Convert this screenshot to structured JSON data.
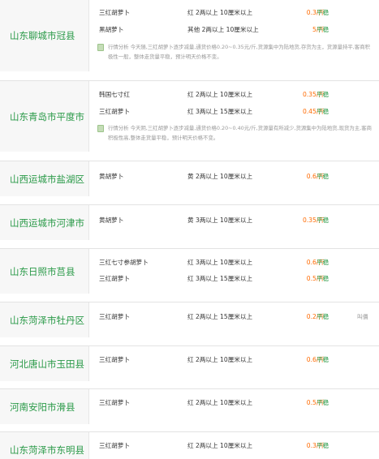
{
  "markets": [
    {
      "region": "山东聊城市冠县",
      "rows": [
        {
          "name": "三红胡萝卜",
          "spec": "红 2两以上 10厘米以上",
          "price": "0.3/斤",
          "trend": "平稳",
          "extra": ""
        },
        {
          "name": "黑胡萝卜",
          "spec": "其他 2两以上 10厘米以上",
          "price": "5/斤",
          "trend": "平稳",
          "extra": ""
        }
      ],
      "note": "行情分析 今天随,三红胡萝卜逐步减量,通货价格0.20~0.35元/斤,货源集中为陆地货,存货为主，货源量持平,客商积极性一般，整体走货量平稳，预计明天价格不变。"
    },
    {
      "region": "山东青岛市平度市",
      "rows": [
        {
          "name": "韩国七寸红",
          "spec": "红 2两以上 10厘米以上",
          "price": "0.35/斤",
          "trend": "平稳",
          "extra": ""
        },
        {
          "name": "三红胡萝卜",
          "spec": "红 3两以上 15厘米以上",
          "price": "0.45/斤",
          "trend": "平稳",
          "extra": ""
        }
      ],
      "note": "行情分析 今天阴,三红胡萝卜逐步减量,通货价格0.20~0.40元/斤,货源量有所减少,货源集中为陆地货,现货为主,客商积极性高,整体走货量平稳，预计明天价格不变。"
    },
    {
      "region": "山西运城市盐湖区",
      "rows": [
        {
          "name": "黄胡萝卜",
          "spec": "黄 2两以上 10厘米以上",
          "price": "0.6/斤",
          "trend": "平稳",
          "extra": ""
        }
      ],
      "note": ""
    },
    {
      "region": "山西运城市河津市",
      "rows": [
        {
          "name": "黄胡萝卜",
          "spec": "黄 3两以上 10厘米以上",
          "price": "0.35/斤",
          "trend": "平稳",
          "extra": ""
        }
      ],
      "note": ""
    },
    {
      "region": "山东日照市莒县",
      "rows": [
        {
          "name": "三红七寸参胡萝卜",
          "spec": "红 3两以上 10厘米以上",
          "price": "0.6/斤",
          "trend": "平稳",
          "extra": ""
        },
        {
          "name": "三红胡萝卜",
          "spec": "红 3两以上 15厘米以上",
          "price": "0.5/斤",
          "trend": "平稳",
          "extra": ""
        }
      ],
      "note": ""
    },
    {
      "region": "山东菏泽市牡丹区",
      "rows": [
        {
          "name": "三红胡萝卜",
          "spec": "红 2两以上 15厘米以上",
          "price": "0.2/斤",
          "trend": "平稳",
          "extra": "叫價"
        }
      ],
      "note": ""
    },
    {
      "region": "河北唐山市玉田县",
      "rows": [
        {
          "name": "三红胡萝卜",
          "spec": "红 2两以上 10厘米以上",
          "price": "0.6/斤",
          "trend": "平稳",
          "extra": ""
        }
      ],
      "note": ""
    },
    {
      "region": "河南安阳市滑县",
      "rows": [
        {
          "name": "三红胡萝卜",
          "spec": "红 2两以上 10厘米以上",
          "price": "0.5/斤",
          "trend": "平稳",
          "extra": ""
        }
      ],
      "note": ""
    },
    {
      "region": "山东菏泽市东明县",
      "rows": [
        {
          "name": "三红胡萝卜",
          "spec": "红 2两以上 10厘米以上",
          "price": "0.3/斤",
          "trend": "平稳",
          "extra": ""
        }
      ],
      "note": ""
    }
  ]
}
